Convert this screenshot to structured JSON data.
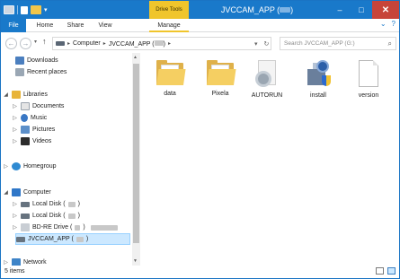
{
  "window": {
    "title": "JVCCAM_APP (",
    "context_tab": "Drive Tools",
    "controls": {
      "minimize": "–",
      "maximize": "□",
      "close": "✕"
    }
  },
  "ribbon": {
    "tabs": [
      {
        "label": "File"
      },
      {
        "label": "Home"
      },
      {
        "label": "Share"
      },
      {
        "label": "View"
      },
      {
        "label": "Manage"
      }
    ],
    "help": "?"
  },
  "address": {
    "back": "←",
    "forward": "→",
    "history": "▾",
    "up": "↑",
    "crumbs": [
      "Computer",
      "JVCCAM_APP ("
    ],
    "separator": "▸",
    "dropdown": "▾",
    "refresh": "↻",
    "search_placeholder": "Search JVCCAM_APP (G:)",
    "search_icon": "⌕"
  },
  "nav": {
    "items": [
      {
        "label": "Downloads",
        "icon": "downloads-icon",
        "kind": "dl"
      },
      {
        "label": "Recent places",
        "icon": "recent-places-icon",
        "kind": "recent"
      },
      {
        "label": "Libraries",
        "icon": "libraries-icon",
        "kind": "lib",
        "expand": "◢"
      },
      {
        "label": "Documents",
        "icon": "documents-icon",
        "kind": "doc",
        "expand": "▷"
      },
      {
        "label": "Music",
        "icon": "music-icon",
        "kind": "music",
        "expand": "▷"
      },
      {
        "label": "Pictures",
        "icon": "pictures-icon",
        "kind": "pic",
        "expand": "▷"
      },
      {
        "label": "Videos",
        "icon": "videos-icon",
        "kind": "vid",
        "expand": "▷"
      },
      {
        "label": "Homegroup",
        "icon": "homegroup-icon",
        "kind": "home",
        "expand": "▷"
      },
      {
        "label": "Computer",
        "icon": "computer-icon",
        "kind": "comp",
        "expand": "◢"
      },
      {
        "label": "Local Disk (",
        "icon": "local-disk-icon",
        "kind": "disk",
        "expand": "▷"
      },
      {
        "label": "Local Disk (",
        "icon": "local-disk-icon",
        "kind": "disk",
        "expand": "▷"
      },
      {
        "label": "BD-RE Drive (",
        "icon": "bd-drive-icon",
        "kind": "bd",
        "expand": "▷"
      },
      {
        "label": "JVCCAM_APP (",
        "icon": "usb-drive-icon",
        "kind": "disk",
        "selected": true
      },
      {
        "label": "Network",
        "icon": "network-icon",
        "kind": "net",
        "expand": "▷"
      }
    ]
  },
  "files": [
    {
      "name": "data",
      "type": "folder"
    },
    {
      "name": "Pixela",
      "type": "folder"
    },
    {
      "name": "AUTORUN",
      "type": "autorun"
    },
    {
      "name": "install",
      "type": "install"
    },
    {
      "name": "version",
      "type": "doc"
    }
  ],
  "status": {
    "count": "5 items"
  },
  "colors": {
    "accent": "#1979ca",
    "context_tab": "#f0c52c",
    "close": "#c7443a",
    "selection": "#cce8ff"
  }
}
